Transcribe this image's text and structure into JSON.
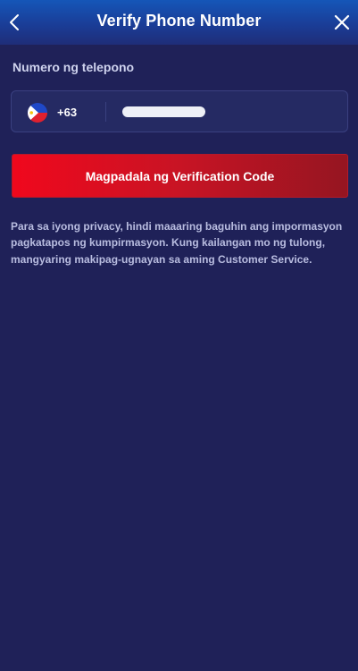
{
  "header": {
    "title": "Verify Phone Number",
    "back_icon": "chevron-left-icon",
    "close_icon": "close-icon"
  },
  "phone": {
    "label": "Numero ng telepono",
    "country_flag": "philippines-flag-icon",
    "dial_code": "+63",
    "value": ""
  },
  "send_button": {
    "label": "Magpadala ng Verification Code"
  },
  "notice": {
    "text": "Para sa iyong privacy, hindi maaaring baguhin ang impormasyon pagkatapos ng kumpirmasyon. Kung kailangan mo ng tulong, mangyaring makipag-ugnayan sa aming Customer Service."
  },
  "colors": {
    "background": "#1f2158",
    "header": "#1a3d97",
    "button_start": "#f0081d",
    "button_end": "#951521",
    "muted_text": "#b9bde0"
  }
}
